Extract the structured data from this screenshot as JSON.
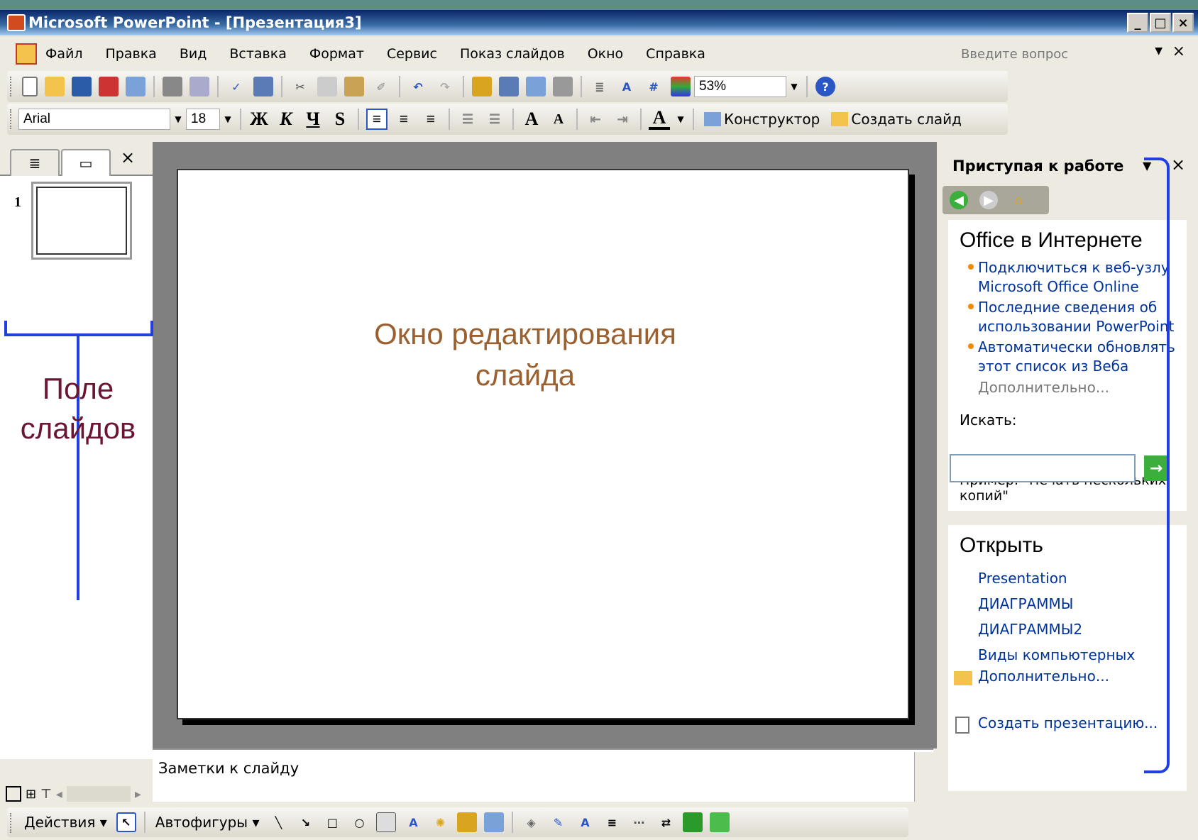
{
  "window": {
    "title": "Microsoft PowerPoint - [Презентация3]",
    "min": "_",
    "max": "□",
    "close": "×"
  },
  "menu": {
    "items": [
      "Файл",
      "Правка",
      "Вид",
      "Вставка",
      "Формат",
      "Сервис",
      "Показ слайдов",
      "Окно",
      "Справка"
    ],
    "ask_placeholder": "Введите вопрос",
    "ask_close": "×"
  },
  "standard_toolbar": {
    "zoom": "53%"
  },
  "format_toolbar": {
    "font": "Arial",
    "size": "18",
    "bold": "Ж",
    "italic": "К",
    "underline": "Ч",
    "shadow": "S",
    "designer": "Конструктор",
    "new_slide": "Создать слайд"
  },
  "slides_panel": {
    "slide_number": "1",
    "close": "×"
  },
  "notes": {
    "placeholder": "Заметки к слайду"
  },
  "task_pane": {
    "title": "Приступая к работе",
    "office_online": {
      "heading": "Office в Интернете",
      "links": [
        "Подключиться к веб-узлу Microsoft Office Online",
        "Последние сведения об использовании PowerPoint",
        "Автоматически обновлять этот список из Веба"
      ],
      "more": "Дополнительно...",
      "search_label": "Искать:",
      "example": "Пример: \"Печать нескольких копий\""
    },
    "open": {
      "heading": "Открыть",
      "files": [
        "Presentation",
        "ДИАГРАММЫ",
        "ДИАГРАММЫ2",
        "Виды компьютерных"
      ],
      "more": "Дополнительно...",
      "create": "Создать презентацию..."
    }
  },
  "drawing_toolbar": {
    "actions": "Действия ▾",
    "autoshapes": "Автофигуры ▾"
  },
  "annotations": {
    "left_label": "Поле слайдов",
    "center_label": "Окно редактирования слайда"
  },
  "colors": {
    "annotation_brown": "#9a6030",
    "annotation_maroon": "#6b1530",
    "bracket_blue": "#1f3fe0",
    "link_blue": "#003399"
  }
}
